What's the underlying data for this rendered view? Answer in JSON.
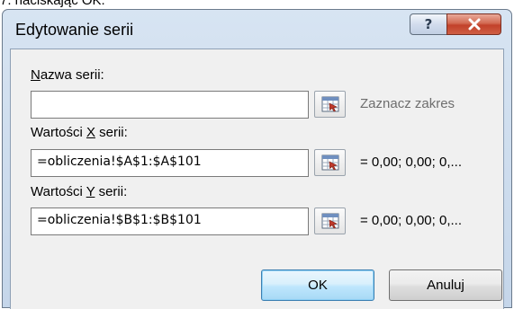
{
  "top_strip_text": "7. naciskając OK.",
  "dialog": {
    "title": "Edytowanie serii",
    "help_symbol": "?",
    "close_symbol": "X"
  },
  "series_name": {
    "label_mnemonic": "N",
    "label_rest": "azwa serii:",
    "value": "",
    "preview": "Zaznacz zakres"
  },
  "x_values": {
    "label_before": "Wartości ",
    "label_mnemonic": "X",
    "label_after": " serii:",
    "value": "=obliczenia!$A$1:$A$101",
    "preview": "= 0,00; 0,00; 0,..."
  },
  "y_values": {
    "label_before": "Wartości ",
    "label_mnemonic": "Y",
    "label_after": " serii:",
    "value": "=obliczenia!$B$1:$B$101",
    "preview": "= 0,00; 0,00; 0,..."
  },
  "buttons": {
    "ok": "OK",
    "cancel": "Anuluj"
  },
  "icons": {
    "range_selector": "collapse-dialog-icon",
    "help": "help-icon",
    "close": "close-icon"
  },
  "colors": {
    "window_frame": "#c5d6ea",
    "close_button": "#c2412a",
    "client_area": "#f0f0f0",
    "default_button_border": "#3c7fb1",
    "hint_text": "#6e6e6e"
  }
}
